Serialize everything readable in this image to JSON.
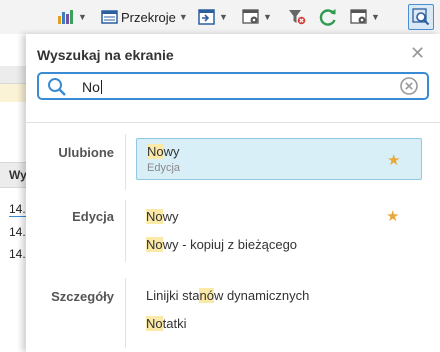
{
  "toolbar": {
    "items": [
      {
        "name": "chart-icon"
      },
      {
        "name": "report-icon",
        "label": "Przekroje"
      },
      {
        "name": "import-icon"
      },
      {
        "name": "settings-grid-icon"
      },
      {
        "name": "filter-clear-icon"
      },
      {
        "name": "refresh-icon"
      },
      {
        "name": "column-settings-icon"
      },
      {
        "name": "search-screen-icon"
      }
    ],
    "reports_label": "Przekroje"
  },
  "background": {
    "col_header": "Wy",
    "rows": [
      "14.",
      "14.",
      "14."
    ]
  },
  "search_panel": {
    "title": "Wyszukaj na ekranie",
    "query": "No",
    "sections": [
      {
        "label": "Ulubione",
        "results": [
          {
            "match": "No",
            "rest": "wy",
            "sub": "Edycja",
            "favorite": true,
            "selected": true
          }
        ]
      },
      {
        "label": "Edycja",
        "results": [
          {
            "match": "No",
            "rest": "wy",
            "favorite": true
          },
          {
            "match": "No",
            "rest": "wy - kopiuj z bieżącego",
            "favorite": false
          }
        ]
      },
      {
        "label": "Szczegóły",
        "results": [
          {
            "pre": "Linijki sta",
            "match": "nó",
            "rest": "w dynamicznych",
            "favorite": false
          },
          {
            "match": "No",
            "rest": "tatki",
            "favorite": false
          }
        ]
      }
    ]
  },
  "colors": {
    "accent": "#3b8ad4",
    "highlight": "#fbe9a8",
    "selected_bg": "#d9eff7",
    "star": "#e8a93a"
  }
}
